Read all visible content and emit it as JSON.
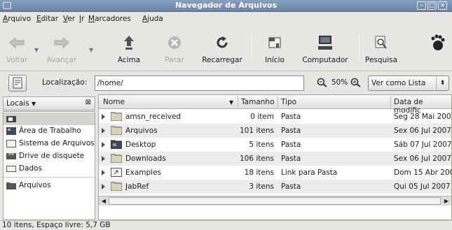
{
  "window": {
    "title": "Navegador de Arquivos"
  },
  "menubar": [
    "Arquivo",
    "Editar",
    "Ver",
    "Ir",
    "Marcadores",
    "Ajuda"
  ],
  "toolbar": {
    "back": "Voltar",
    "forward": "Avançar",
    "up": "Acima",
    "stop": "Parar",
    "reload": "Recarregar",
    "home": "Início",
    "computer": "Computador",
    "search": "Pesquisa"
  },
  "location": {
    "label": "Localização:",
    "value": "/home/",
    "zoom": "50%",
    "view": "Ver como Lista"
  },
  "sidebar": {
    "header": "Locais",
    "items": [
      {
        "label": "",
        "icon": "home-folder-icon"
      },
      {
        "label": "Área de Trabalho",
        "icon": "desktop-icon"
      },
      {
        "label": "Sistema de Arquivos",
        "icon": "filesystem-icon"
      },
      {
        "label": "Drive de disquete",
        "icon": "floppy-icon"
      },
      {
        "label": "Dados",
        "icon": "drive-icon"
      },
      {
        "label": "Arquivos",
        "icon": "folder-icon"
      }
    ]
  },
  "columns": {
    "name": "Nome",
    "size": "Tamanho",
    "type": "Tipo",
    "date": "Data de modific"
  },
  "files": [
    {
      "name": "amsn_received",
      "size": "0 item",
      "type": "Pasta",
      "date": "Seg 28 Mai 2007",
      "icon": "folder-icon"
    },
    {
      "name": "Arquivos",
      "size": "101 itens",
      "type": "Pasta",
      "date": "Sex 06 Jul 2007",
      "icon": "folder-icon"
    },
    {
      "name": "Desktop",
      "size": "5 itens",
      "type": "Pasta",
      "date": "Sáb 07 Jul 2007",
      "icon": "desktop-folder-icon"
    },
    {
      "name": "Downloads",
      "size": "106 itens",
      "type": "Pasta",
      "date": "Sex 06 Jul 2007",
      "icon": "folder-icon"
    },
    {
      "name": "Examples",
      "size": "18 itens",
      "type": "Link para Pasta",
      "date": "Dom 15 Abr 200",
      "icon": "folder-link-icon"
    },
    {
      "name": "JabRef",
      "size": "3 itens",
      "type": "Pasta",
      "date": "Qui 05 Jul 2007",
      "icon": "folder-icon"
    }
  ],
  "status": "10 itens, Espaço livre: 5,7 GB",
  "colors": {
    "titlebar": "#7790b3",
    "folder": "#d9d2b8",
    "selection": "#d6d4d0"
  }
}
